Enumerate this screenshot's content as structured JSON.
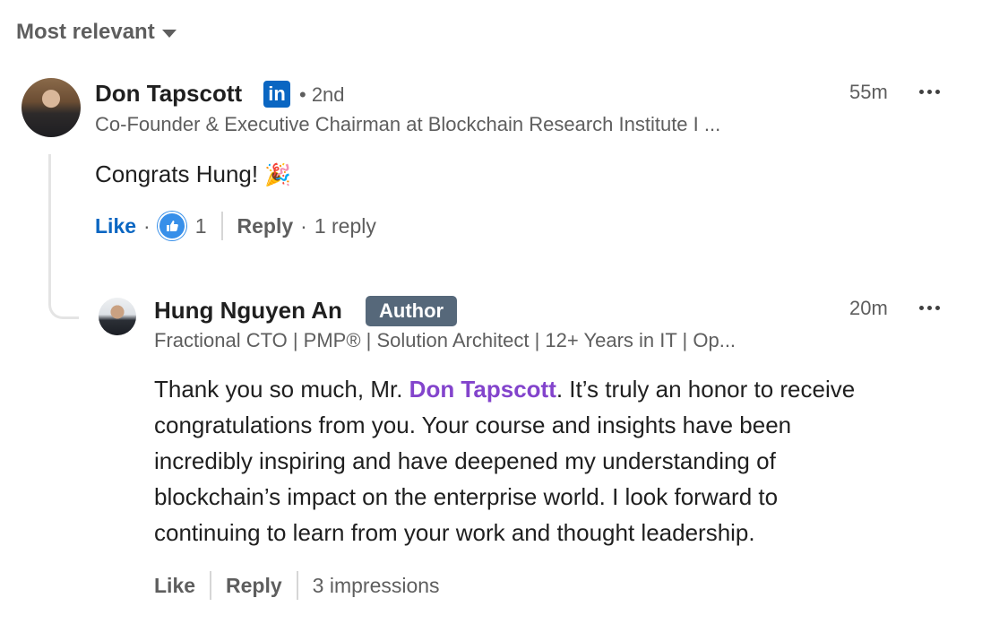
{
  "sort": {
    "label": "Most relevant"
  },
  "comment": {
    "author": {
      "name": "Don Tapscott",
      "badge_text": "in",
      "degree": "• 2nd",
      "headline": "Co-Founder & Executive Chairman at Blockchain Research Institute I ..."
    },
    "time": "55m",
    "text": "Congrats Hung! ",
    "emoji": "🎉",
    "actions": {
      "like_label": "Like",
      "dot1": "·",
      "reaction_count": "1",
      "reply_label": "Reply",
      "dot2": "·",
      "reply_count": "1 reply"
    },
    "colors": {
      "like_blue": "#0a66c2",
      "reaction_blue": "#378fe9"
    }
  },
  "reply": {
    "author": {
      "name": "Hung Nguyen An",
      "badge": "Author",
      "headline": "Fractional CTO | PMP® | Solution Architect | 12+ Years in IT | Op..."
    },
    "time": "20m",
    "text_before": "Thank you so much, Mr. ",
    "mention": "Don Tapscott",
    "text_line1_after": ". It’s truly an honor to receive",
    "text_line2": "congratulations from you. Your course and insights have been",
    "text_line3": "incredibly inspiring and have deepened my understanding of",
    "text_line4": "blockchain’s impact on the enterprise world. I look forward to",
    "text_line5": "continuing to learn from your work and thought leadership.",
    "actions": {
      "like_label": "Like",
      "reply_label": "Reply",
      "impressions": "3 impressions"
    },
    "colors": {
      "mention": "#8344cc",
      "author_badge": "#56687a"
    }
  }
}
